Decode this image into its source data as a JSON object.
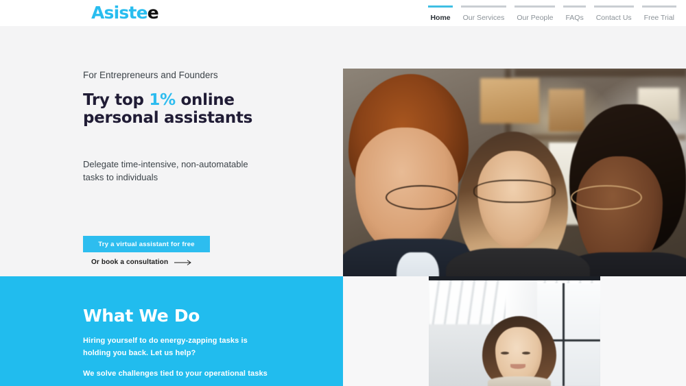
{
  "header": {
    "logo": {
      "primary": "Asiste",
      "secondary": "e",
      "color_primary": "#29BDEF",
      "color_secondary": "#111111"
    },
    "nav": [
      {
        "label": "Home",
        "active": true
      },
      {
        "label": "Our Services",
        "active": false
      },
      {
        "label": "Our People",
        "active": false
      },
      {
        "label": "FAQs",
        "active": false
      },
      {
        "label": "Contact Us",
        "active": false
      },
      {
        "label": "Free Trial",
        "active": false
      }
    ]
  },
  "hero": {
    "eyebrow": "For Entrepreneurs and Founders",
    "headline_part1": "Try top ",
    "headline_accent": "1%",
    "headline_part2": " online",
    "headline_line2": "personal assistants",
    "subcopy": "Delegate time-intensive, non-automatable tasks to individuals",
    "cta_label": "Try a virtual assistant for free",
    "secondary_cta_label": "Or book a consultation",
    "photo_alt": "Three colleagues laughing together in an office"
  },
  "what_we_do": {
    "title": "What We Do",
    "lead": "Hiring yourself to do energy-zapping tasks is holding you back. Let us help?",
    "sub": "We solve challenges tied to your operational tasks",
    "photo_alt": "Smiling woman standing in a bright office"
  },
  "colors": {
    "accent": "#21BCEE",
    "accent_button": "#2DBDEF",
    "headline": "#201C35",
    "hero_bg": "#F4F4F5",
    "panel_bg": "#F7F7F8",
    "nav_inactive": "#8a9197",
    "nav_rule": "#c9ced2"
  }
}
